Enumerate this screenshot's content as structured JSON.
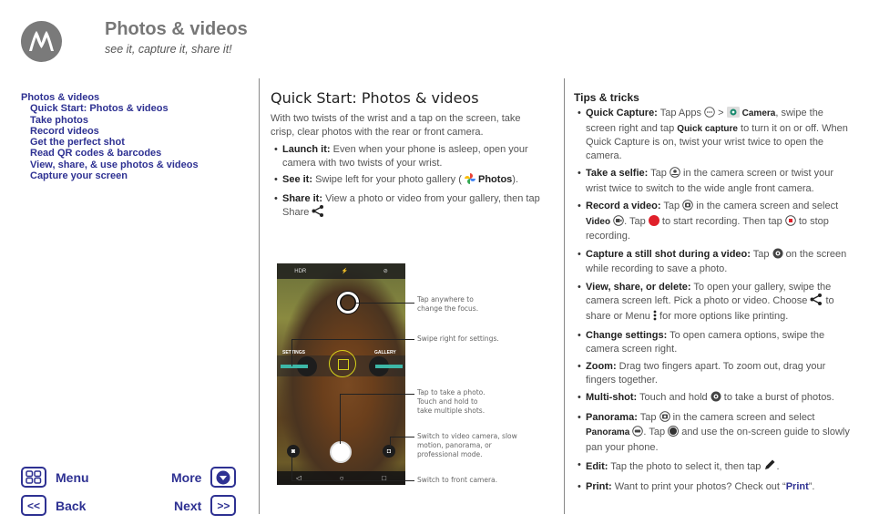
{
  "header": {
    "title": "Photos & videos",
    "subtitle": "see it, capture it, share it!"
  },
  "toc": {
    "heading": "Photos & videos",
    "items": [
      "Quick Start: Photos & videos",
      "Take photos",
      "Record videos",
      "Get the perfect shot",
      "Read QR codes & barcodes",
      "View, share, & use photos & videos",
      "Capture your screen"
    ]
  },
  "nav": {
    "menu": "Menu",
    "more": "More",
    "back": "Back",
    "next": "Next",
    "back_glyph": "<<",
    "next_glyph": ">>"
  },
  "quickstart": {
    "title": "Quick Start: Photos & videos",
    "intro": "With two twists of the wrist and a tap on the screen, take crisp, clear photos with the rear or front camera.",
    "bullets": [
      {
        "label": "Launch it:",
        "text": " Even when your phone is asleep, open your camera with two twists of your wrist."
      },
      {
        "label": "See it:",
        "text": " Swipe left for your photo gallery (",
        "app": "Photos",
        "tail": ")."
      },
      {
        "label": "Share it:",
        "text": " View a photo or video from your gallery, then tap Share "
      }
    ]
  },
  "phone": {
    "top_icons": [
      "hdr-icon",
      "flash-icon",
      "timer-off-icon"
    ],
    "settings_label": "SETTINGS",
    "gallery_label": "GALLERY"
  },
  "callouts": [
    "Tap anywhere to change the focus.",
    "Swipe right for settings.",
    "Tap to take a photo. Touch and hold to take multiple shots.",
    "Switch to video camera, slow motion, panorama, or professional mode.",
    "Switch to front camera."
  ],
  "tips": {
    "title": "Tips & tricks",
    "quick_capture": {
      "label": "Quick Capture:",
      "t1": " Tap Apps ",
      "t2": " > ",
      "camera": "Camera",
      "t3": ", swipe the screen right and tap ",
      "qc": "Quick capture",
      "t4": " to turn it on or off. When Quick Capture is on, twist your wrist twice to open the camera."
    },
    "selfie": {
      "label": "Take a selfie:",
      "t1": " Tap ",
      "t2": " in the camera screen or twist your wrist twice to switch to the wide angle front camera."
    },
    "record": {
      "label": "Record a video:",
      "t1": " Tap ",
      "t2": " in the camera screen and select ",
      "video": "Video",
      "t3": ". Tap ",
      "t4": " to start recording. Then tap ",
      "t5": " to stop recording."
    },
    "still": {
      "label": "Capture a still shot during a video:",
      "t1": " Tap ",
      "t2": " on the screen while recording to save a photo."
    },
    "view": {
      "label": "View, share, or delete:",
      "t1": " To open your gallery, swipe the camera screen left. Pick a photo or video. Choose ",
      "t2": " to share or Menu ",
      "t3": " for more options like printing."
    },
    "settings": {
      "label": "Change settings:",
      "t1": " To open camera options, swipe the camera screen right."
    },
    "zoom": {
      "label": "Zoom:",
      "t1": " Drag two fingers apart. To zoom out, drag your fingers together."
    },
    "multishot": {
      "label": "Multi-shot:",
      "t1": " Touch and hold ",
      "t2": " to take a burst of photos."
    },
    "panorama": {
      "label": "Panorama:",
      "t1": " Tap ",
      "t2": " in the camera screen and select ",
      "pano": "Panorama",
      "t3": ". Tap ",
      "t4": " and use the on-screen guide to slowly pan your phone."
    },
    "edit": {
      "label": "Edit:",
      "t1": " Tap the photo to select it, then tap ",
      "t2": "."
    },
    "print": {
      "label": "Print:",
      "t1": " Want to print your photos? Check out “",
      "link": "Print",
      "t2": "”."
    }
  },
  "colors": {
    "brand_blue": "#2e3192",
    "logo_gray": "#7a7a7a",
    "record_red": "#e0202a",
    "teal_arrow": "#3db7a7"
  }
}
